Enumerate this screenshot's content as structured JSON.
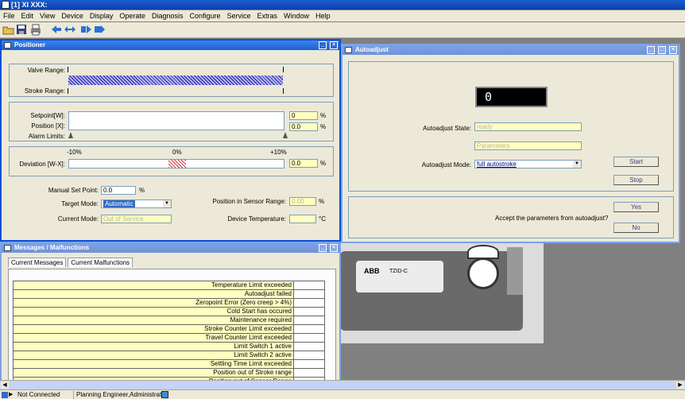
{
  "app": {
    "title": "[1] XI XXX:"
  },
  "menu": [
    "File",
    "Edit",
    "View",
    "Device",
    "Display",
    "Operate",
    "Diagnosis",
    "Configure",
    "Service",
    "Extras",
    "Window",
    "Help"
  ],
  "positioner": {
    "title": "Positioner",
    "valve_range_label": "Valve Range:",
    "stroke_range_label": "Stroke Range:",
    "setpoint_label": "Setpoint[W]:",
    "position_label": "Position [X]:",
    "alarm_limits_label": "Alarm Limits:",
    "setpoint_value": "0",
    "position_value": "0.0",
    "unit_pct": "%",
    "dev_tick_neg": "-10%",
    "dev_tick_zero": "0%",
    "dev_tick_pos": "+10%",
    "deviation_label": "Deviation [W-X]:",
    "deviation_value": "0.0",
    "manual_set_point_label": "Manual Set Point:",
    "manual_set_point_value": "0.0",
    "target_mode_label": "Target Mode:",
    "target_mode_value": "Automatic",
    "current_mode_label": "Current Mode:",
    "current_mode_value": "Out of Service",
    "sensor_range_label": "Position in Sensor Range:",
    "sensor_range_value": "0.00",
    "device_temp_label": "Device Temperature:",
    "device_temp_unit": "°C"
  },
  "autoadjust": {
    "title": "Autoadjust",
    "display_value": "0",
    "state_label": "Autoadjust State:",
    "state_value": "ready",
    "sub_value": "Parameters",
    "mode_label": "Autoadjust Mode:",
    "mode_value": "full autostroke",
    "start_label": "Start",
    "stop_label": "Stop",
    "yes_label": "Yes",
    "no_label": "No",
    "accept_question": "Accept the parameters from autoadjust?"
  },
  "messages": {
    "title": "Messages / Malfunctions",
    "tabs": [
      "Current Messages",
      "Current Malfunctions"
    ],
    "rows": [
      "Temperature Limit exceeded",
      "Autoadjust failed",
      "Zeropoint Error (Zero creep > 4%)",
      "Cold Start has occured",
      "Maintenance required",
      "Stroke Counter Limit exceeded",
      "Travel Counter Limit exceeded",
      "Limit Switch 1 active",
      "Limit Switch 2 active",
      "Settling Time Limit exceeded",
      "Position out of Stroke range",
      "Position out of Sensor Range"
    ]
  },
  "device_photo": {
    "brand": "ABB",
    "model": "TZID-C"
  },
  "status": {
    "connection": "Not Connected",
    "user": "Planning Engineer,Administrator"
  },
  "colors": {
    "title_blue": "#0a4fd6",
    "field_yellow": "#ffffc0",
    "hatch_blue": "#2a2ab8",
    "deviation_red": "#d04040"
  }
}
